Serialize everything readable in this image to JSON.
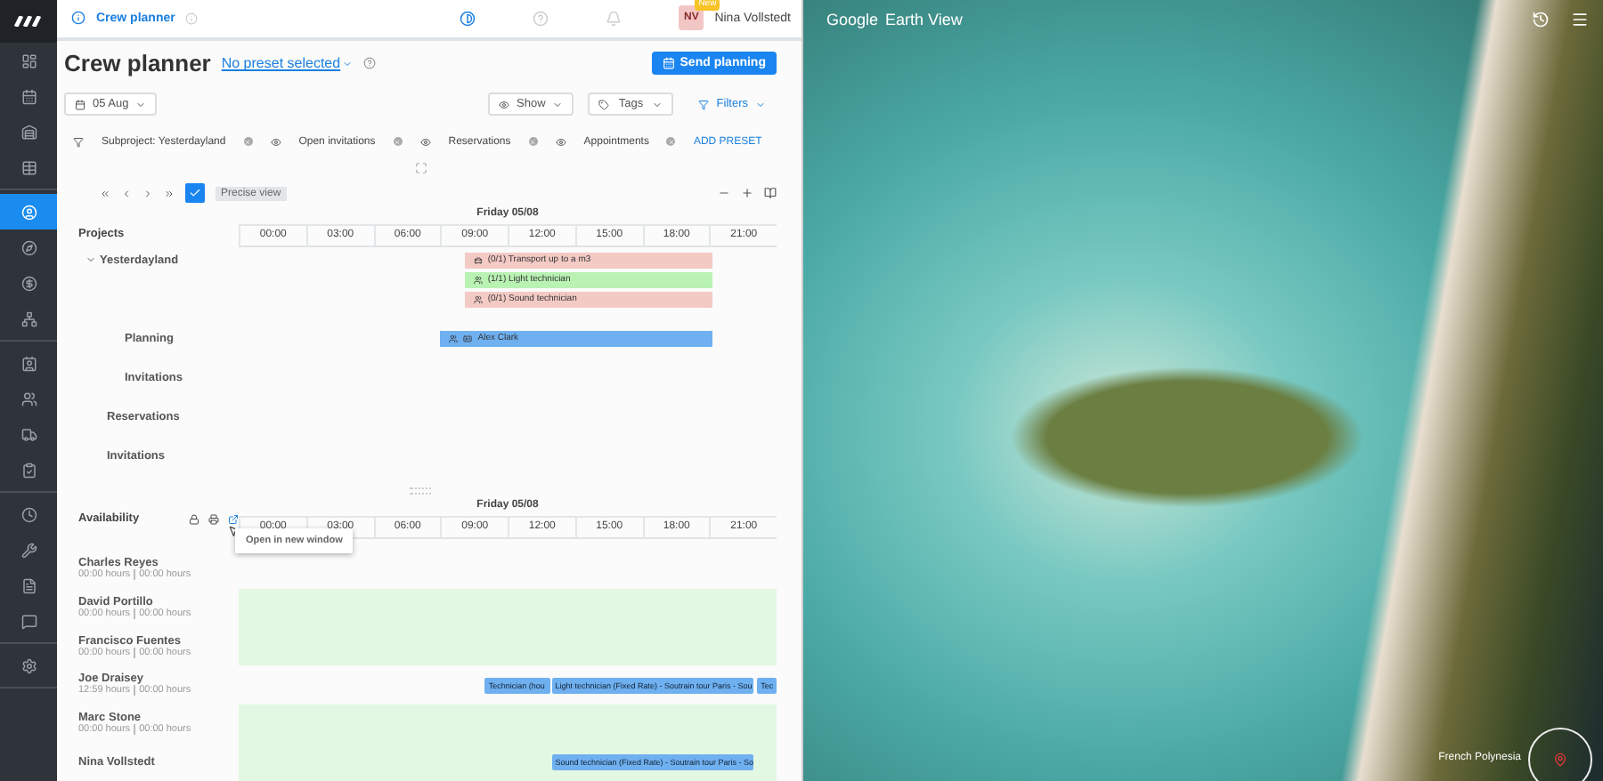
{
  "sidebar": [
    {
      "selected": false
    },
    {
      "selected": false
    },
    {
      "selected": false
    },
    {
      "selected": false
    },
    {
      "selected": true
    },
    {
      "selected": false
    },
    {
      "selected": false
    },
    {
      "selected": false
    },
    {
      "selected": false
    },
    {
      "selected": false
    },
    {
      "selected": false
    },
    {
      "selected": false
    },
    {
      "selected": false
    },
    {
      "selected": false
    },
    {
      "selected": false
    },
    {
      "selected": false
    },
    {
      "selected": false
    }
  ],
  "header": {
    "breadcrumb": "Crew planner",
    "user": {
      "initials": "NV",
      "badge": "New",
      "name": "Nina Vollstedt"
    }
  },
  "title": "Crew planner",
  "preset": "No preset selected",
  "send_button": "Send planning",
  "date": "05 Aug",
  "dropdowns": [
    {
      "label": "Show",
      "kind": "eye"
    },
    {
      "label": "Tags",
      "kind": "tag"
    },
    {
      "label": "Filters",
      "kind": "filter"
    }
  ],
  "chips": [
    {
      "label": "Subproject: Yesterdayland",
      "kind": "filter"
    },
    {
      "label": "Open invitations",
      "kind": "eye"
    },
    {
      "label": "Reservations",
      "kind": "eye"
    },
    {
      "label": "Appointments",
      "kind": "eye"
    }
  ],
  "add_preset": "ADD PRESET",
  "precise_view": {
    "label": "Precise view",
    "checked": true
  },
  "projects": {
    "heading": "Projects",
    "day": "Friday 05/08",
    "times": [
      "00:00",
      "03:00",
      "06:00",
      "09:00",
      "12:00",
      "15:00",
      "18:00",
      "21:00"
    ],
    "rows": [
      {
        "label": "Yesterdayland",
        "expanded": true,
        "bars": [
          {
            "label": "(0/1) Transport up to a m3",
            "kind": "vehicle",
            "color": "#f4cac5"
          },
          {
            "label": "(1/1) Light technician",
            "kind": "crew",
            "color": "#b9f2b3"
          },
          {
            "label": "(0/1) Sound technician",
            "kind": "crew",
            "color": "#f4cac5"
          }
        ],
        "children": [
          {
            "label": "Planning",
            "bars": [
              {
                "label": "Alex Clark",
                "kind": "person",
                "color": "#6fb0f0"
              }
            ]
          },
          {
            "label": "Invitations"
          }
        ]
      },
      {
        "label": "Reservations"
      },
      {
        "label": "Invitations"
      }
    ]
  },
  "availability": {
    "heading": "Availability",
    "day": "Friday 05/08",
    "times": [
      "00:00",
      "03:00",
      "06:00",
      "09:00",
      "12:00",
      "15:00",
      "18:00",
      "21:00"
    ],
    "tooltip": "Open in new window",
    "people": [
      {
        "name": "Charles Reyes",
        "hours": "00:00 hours",
        "planned": "00:00 hours",
        "available": false
      },
      {
        "name": "David Portillo",
        "hours": "00:00 hours",
        "planned": "00:00 hours",
        "available": true
      },
      {
        "name": "Francisco Fuentes",
        "hours": "00:00 hours",
        "planned": "00:00 hours",
        "available": true
      },
      {
        "name": "Joe Draisey",
        "hours": "12:59 hours",
        "planned": "00:00 hours",
        "available": false,
        "bars": [
          "Technician (hou",
          "Light technician (Fixed Rate) - Soutrain tour Paris - Sou",
          "Tec"
        ]
      },
      {
        "name": "Marc Stone",
        "hours": "00:00 hours",
        "planned": "00:00 hours",
        "available": true
      },
      {
        "name": "Nina Vollstedt",
        "available": true,
        "bars": [
          "Sound technician (Fixed Rate) - Soutrain tour Paris - So"
        ]
      }
    ]
  },
  "earth": {
    "brand": "Google",
    "product": "Earth View",
    "place": "French Polynesia"
  }
}
